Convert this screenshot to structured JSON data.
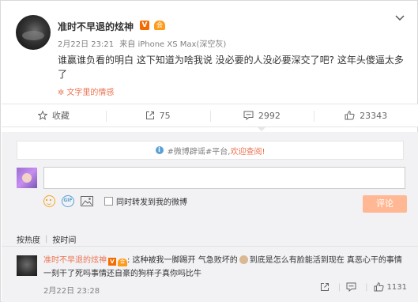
{
  "post": {
    "author": "准时不早退的炫神",
    "vip_label": "V",
    "crown_label": "会",
    "time": "2月22日 23:21",
    "via": "来自 iPhone XS Max(深空灰)",
    "text": "谁赢谁负看的明白 这下知道为啥我说 没必要的人没必要深交了吧? 这年头傻逼太多了",
    "source_tag": "文字里的情感"
  },
  "actions": {
    "favorite": "收藏",
    "repost": "75",
    "comment": "2992",
    "like": "23343"
  },
  "comment_box": {
    "notice_hashtag": "#微博辟谣#平台,",
    "notice_link": "欢迎查阅!",
    "input_value": "",
    "repost_label": "同时转发到我的微博",
    "submit_label": "评论",
    "gif_label": "GIF"
  },
  "sort": {
    "hot": "按热度",
    "time": "按时间"
  },
  "comments": [
    {
      "user": "准时不早退的炫神",
      "vip_label": "V",
      "crown_label": "会",
      "text_before": ": 这种被我一脚踢开 气急败坏的",
      "text_after": "到底是怎么有脸能活到现在 真恶心干的事情 一刻干了死吗事情还自豪的狗样子真你吗比牛",
      "time": "2月22日 23:28",
      "like_count": "1131"
    }
  ],
  "colors": {
    "accent": "#eb7350",
    "submit_disabled": "#ffb893",
    "vip": "#f46c00",
    "panel_bg": "#f2f2f5"
  }
}
